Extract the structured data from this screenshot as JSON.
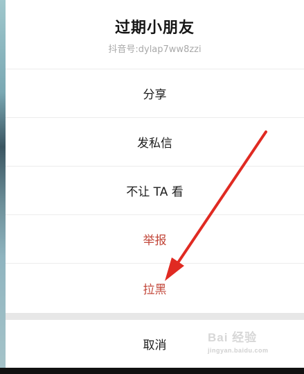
{
  "header": {
    "title": "过期小朋友",
    "subtitle": "抖音号:dylap7ww8zzi"
  },
  "menu": {
    "items": [
      {
        "label": "分享"
      },
      {
        "label": "发私信"
      },
      {
        "label": "不让 TA 看"
      },
      {
        "label": "举报"
      },
      {
        "label": "拉黑"
      }
    ],
    "cancel_label": "取消"
  },
  "colors": {
    "danger": "#c2473a",
    "arrow": "#e02a22",
    "divider": "#ececec"
  },
  "watermark": {
    "brand": "Bai 经验",
    "url": "jingyan.baidu.com"
  }
}
